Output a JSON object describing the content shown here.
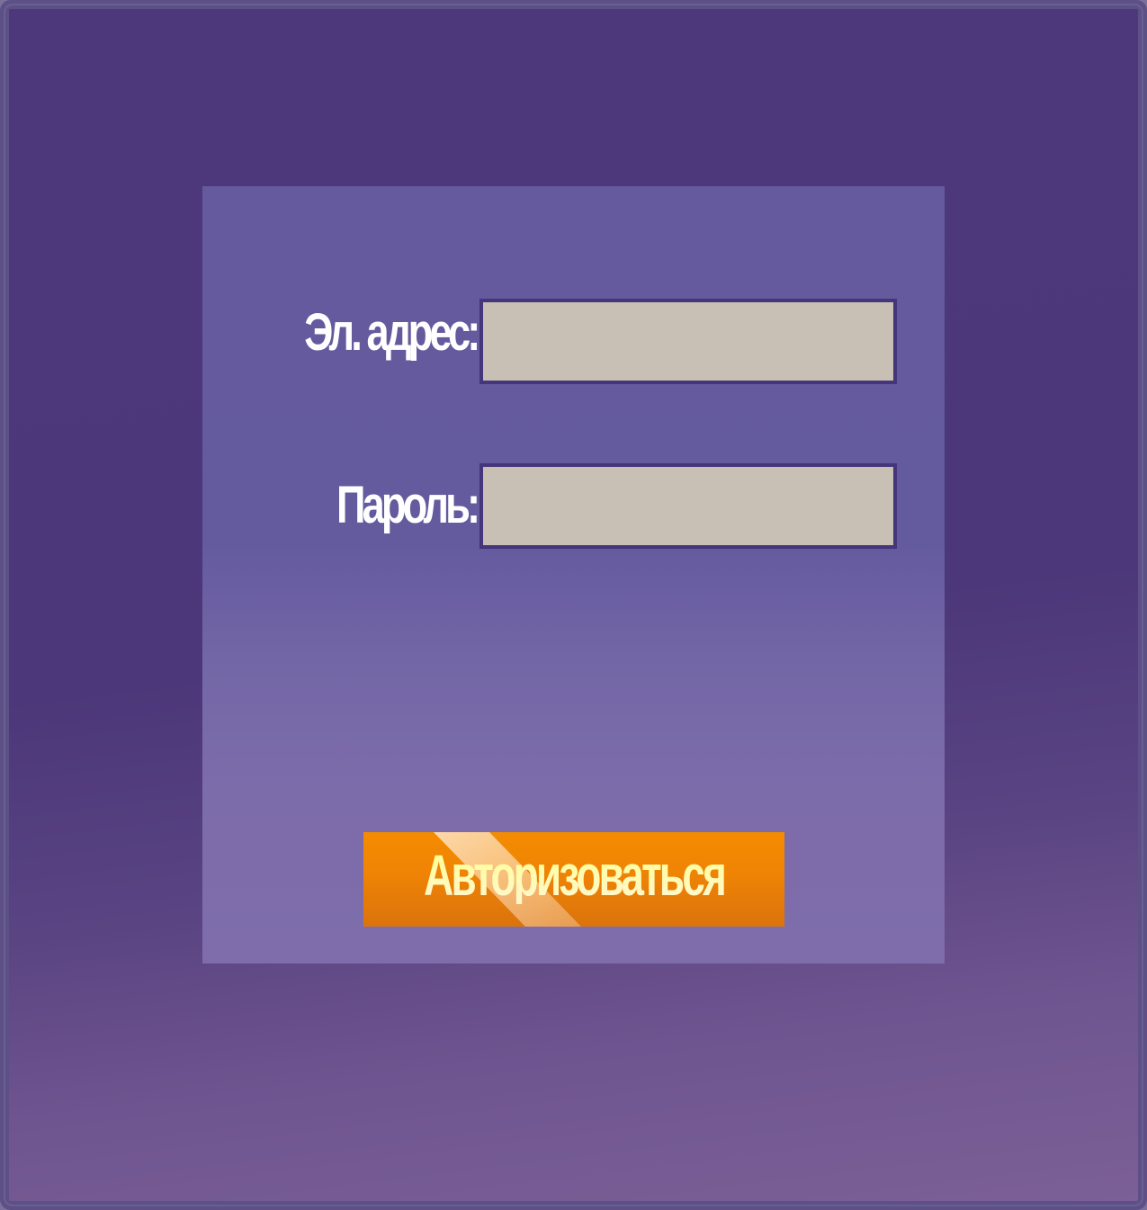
{
  "login_form": {
    "email_label": "Эл. адрес:",
    "email_value": "",
    "password_label": "Пароль:",
    "password_value": "",
    "submit_label": "Авторизоваться"
  },
  "colors": {
    "background": "#4c387a",
    "panel": "#665a9e",
    "input_fill": "#c8c0b4",
    "input_border": "#45357a",
    "button": "#f08400",
    "button_text": "#fff9a8",
    "label_text": "#ffffff"
  }
}
